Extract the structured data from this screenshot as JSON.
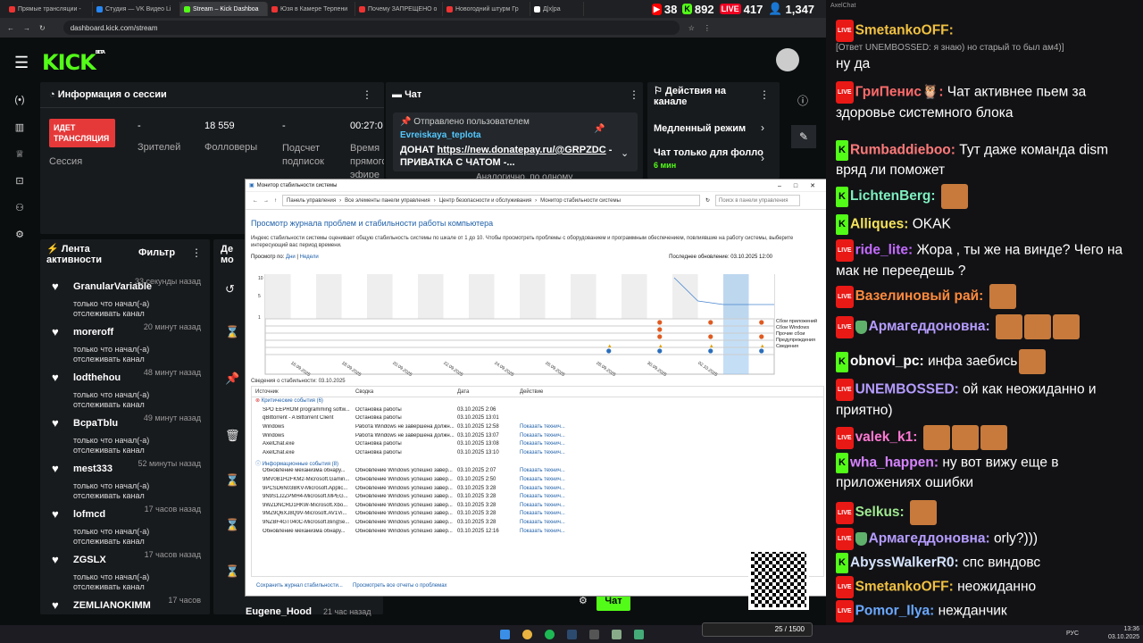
{
  "browser": {
    "tabs": [
      "Прямые трансляции -",
      "Студия — VK Видео Li",
      "Stream – Kick Dashboa",
      "Юзя в Камере Терпени",
      "Почему ЗАПРЕЩЕНО о",
      "Новогодний штурм Гр",
      "Д|х|ра"
    ],
    "url": "dashboard.kick.com/stream"
  },
  "overlay_stats": {
    "youtube": "38",
    "kick": "892",
    "live": "417",
    "viewers": "1,347"
  },
  "kick": {
    "logo": "KICK",
    "logo_badge": "BETA",
    "session": {
      "title": "Информация о сессии",
      "status_badge": "ИДЕТ ТРАНСЛЯЦИЯ",
      "status_label": "Сессия",
      "viewers_value": "-",
      "viewers_label": "Зрителей",
      "followers_value": "18 559",
      "followers_label": "Фолловеры",
      "subs_value": "-",
      "subs_label": "Подсчет подписок",
      "time_value": "00:27:0",
      "time_label": "Время прямого эфире"
    },
    "chat": {
      "title": "Чат",
      "pinned_by": "Отправлено пользователем",
      "pinned_user": "Evreiskaya_teplota",
      "pinned_text_prefix": "ДОНАТ ",
      "pinned_link": "https://new.donatepay.ru/@GRPZDC",
      "pinned_text_suffix": " - ПРИВАТКА С ЧАТОМ -...",
      "behind_text": "Аналогично, по одному",
      "send_button": "Чат"
    },
    "actions": {
      "title": "Действия на канале",
      "slow_mode": "Медленный режим",
      "followers_only": "Чат только для фолло",
      "followers_only_sub": "6 мин"
    },
    "feed": {
      "title": "Лента активности",
      "filter": "Фильтр",
      "item_text": "только что начал(-а) отслеживать канал",
      "items": [
        {
          "name": "GranularVariable",
          "time": "33 секунды назад"
        },
        {
          "name": "moreroff",
          "time": "20 минут назад"
        },
        {
          "name": "lodthehou",
          "time": "48 минут назад"
        },
        {
          "name": "BcpaTblu",
          "time": "49 минут назад"
        },
        {
          "name": "mest333",
          "time": "52 минуты назад"
        },
        {
          "name": "lofmcd",
          "time": "17 часов назад"
        },
        {
          "name": "ZGSLX",
          "time": "17 часов назад"
        },
        {
          "name": "ZEMLIANOKIMM",
          "time": "17 часов"
        }
      ]
    },
    "mod": {
      "title": "Де мо",
      "bottom_user": "Eugene_Hood",
      "bottom_time": "21 час назад"
    }
  },
  "stability": {
    "window_title": "Монитор стабильности системы",
    "breadcrumb": [
      "Панель управления",
      "Все элементы панели управления",
      "Центр безопасности и обслуживания",
      "Монитор стабильности системы"
    ],
    "search_placeholder": "Поиск в панели управления",
    "heading": "Просмотр журнала проблем и стабильности работы компьютера",
    "description": "Индекс стабильности системы оценивает общую стабильность системы по шкале от 1 до 10. Чтобы просмотреть проблемы с оборудованием и программным обеспечением, повлиявшие на работу системы, выберите интересующий вас период времени.",
    "view_by": "Просмотр по:",
    "view_days": "Дни",
    "view_weeks": "Недели",
    "last_update": "Последнее обновление: 03.10.2025 12:00",
    "y_ticks": [
      "10",
      "5",
      "1"
    ],
    "legend": [
      "Сбои приложений",
      "Сбои Windows",
      "Прочие сбои",
      "Предупреждения",
      "Сведения"
    ],
    "dates": [
      "16.09.2025",
      "18.09.2025",
      "20.09.2025",
      "22.09.2025",
      "24.09.2025",
      "26.09.2025",
      "28.09.2025",
      "30.09.2025",
      "02.10.2025"
    ],
    "details_title": "Сведения о стабильности: 03.10.2025",
    "columns": [
      "Источник",
      "Сводка",
      "Дата",
      "Действие"
    ],
    "critical_group": "Критические события (6)",
    "info_group": "Информационные события (8)",
    "critical_rows": [
      {
        "src": "SPO EEPROM programming softw...",
        "sum": "Остановка работы",
        "date": "03.10.2025 2:06",
        "act": ""
      },
      {
        "src": "qBittorrent - A Bittorrent Client",
        "sum": "Остановка работы",
        "date": "03.10.2025 13:01",
        "act": ""
      },
      {
        "src": "Windows",
        "sum": "Работа Windows не завершена должн...",
        "date": "03.10.2025 12:58",
        "act": "Показать технич..."
      },
      {
        "src": "Windows",
        "sum": "Работа Windows не завершена должн...",
        "date": "03.10.2025 13:07",
        "act": "Показать технич..."
      },
      {
        "src": "AxelChat.exe",
        "sum": "Остановка работы",
        "date": "03.10.2025 13:08",
        "act": "Показать технич..."
      },
      {
        "src": "AxelChat.exe",
        "sum": "Остановка работы",
        "date": "03.10.2025 13:10",
        "act": "Показать технич..."
      }
    ],
    "info_rows": [
      {
        "src": "Обновление механизма обнару...",
        "sum": "Обновление Windows успешно завер...",
        "date": "03.10.2025 2:07",
        "act": "Показать технич..."
      },
      {
        "src": "9MV0B1H2FKM2-Microsoft.Gamin...",
        "sum": "Обновление Windows успешно завер...",
        "date": "03.10.2025 2:50",
        "act": "Показать технич..."
      },
      {
        "src": "9PCSD6N03BKV-Microsoft.Applic...",
        "sum": "Обновление Windows успешно завер...",
        "date": "03.10.2025 3:28",
        "act": "Показать технич..."
      },
      {
        "src": "9N9S1J2ZPMH4-Microsoft.MPEG...",
        "sum": "Обновление Windows успешно завер...",
        "date": "03.10.2025 3:28",
        "act": "Показать технич..."
      },
      {
        "src": "9WZDNCRD1HKW-Microsoft.Xbo...",
        "sum": "Обновление Windows успешно завер...",
        "date": "03.10.2025 3:28",
        "act": "Показать технич..."
      },
      {
        "src": "9MZ9Q6XJ8Q9V-Microsoft.AV1Vi...",
        "sum": "Обновление Windows успешно завер...",
        "date": "03.10.2025 3:28",
        "act": "Показать технич..."
      },
      {
        "src": "9NZBF4GT040C-Microsoft.BingSe...",
        "sum": "Обновление Windows успешно завер...",
        "date": "03.10.2025 3:28",
        "act": "Показать технич..."
      },
      {
        "src": "Обновление механизма обнару...",
        "sum": "Обновление Windows успешно завер...",
        "date": "03.10.2025 12:16",
        "act": "Показать технич..."
      }
    ],
    "footer_save": "Сохранить журнал стабильности...",
    "footer_all": "Просмотреть все отчеты о проблемах"
  },
  "chat_overlay": {
    "title": "AxelChat",
    "messages": [
      {
        "p": "lv",
        "user": "SmetankoOFF",
        "color": "#f0c040",
        "text": "",
        "reply": "[Ответ UNEMBOSSED: я знаю) но старый то был ам4)]",
        "text2": "ну да"
      },
      {
        "p": "lv",
        "user": "ГриПенис🦉",
        "color": "#ff6b6b",
        "text": "Чат активнее пьем за здоровье системного блока"
      },
      {
        "p": "kk",
        "user": "Rumbaddieboo",
        "color": "#ff7a7a",
        "text": "Тут даже команда dism вряд ли поможет"
      },
      {
        "p": "kk",
        "user": "LichtenBerg",
        "color": "#7ef0c0",
        "text": ""
      },
      {
        "p": "kk",
        "user": "Alliques",
        "color": "#f5e35a",
        "text": "OKAK"
      },
      {
        "p": "lv",
        "user": "ride_lite",
        "color": "#c36bff",
        "text": "Жора , ты же на винде? Чего на мак не переедешь ?"
      },
      {
        "p": "lv",
        "user": "Вазелиновый рай",
        "color": "#ff8a3d",
        "text": ""
      },
      {
        "p": "lv",
        "user": "Армагеддоновна",
        "color": "#b59cff",
        "text": ""
      },
      {
        "p": "kk",
        "user": "obnovi_pc",
        "color": "#ffffff",
        "text": "инфа заебись"
      },
      {
        "p": "lv",
        "user": "UNEMBOSSED",
        "color": "#b59cff",
        "text": "ой как неожиданно и приятно)"
      },
      {
        "p": "lv",
        "user": "valek_k1",
        "color": "#ff78d2",
        "text": ""
      },
      {
        "p": "kk",
        "user": "wha_happen",
        "color": "#d783ff",
        "text": "ну вот вижу еще в приложениях ошибки"
      },
      {
        "p": "lv",
        "user": "Selkus",
        "color": "#9fe88f",
        "text": ""
      },
      {
        "p": "lv",
        "user": "Армагеддоновна",
        "color": "#b59cff",
        "text": "orly?)))"
      },
      {
        "p": "kk",
        "user": "AbyssWalkerR0",
        "color": "#d6e4ff",
        "text": "спс виндовс"
      },
      {
        "p": "lv",
        "user": "SmetankoOFF",
        "color": "#f0c040",
        "text": "неожиданно"
      },
      {
        "p": "lv",
        "user": "Pomor_Ilya",
        "color": "#6aa8ff",
        "text": "нежданчик"
      }
    ]
  },
  "taskbar": {
    "lang": "РУС",
    "time": "13:36",
    "date": "03.10.2025",
    "widget_count": "25 / 1500"
  }
}
